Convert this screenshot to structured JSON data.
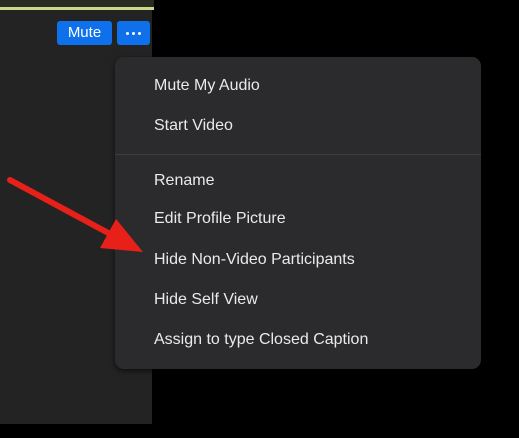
{
  "video_tile": {
    "mute_label": "Mute",
    "more_icon": "ellipsis-icon"
  },
  "menu": {
    "items": [
      {
        "label": "Mute My Audio"
      },
      {
        "label": "Start Video"
      },
      {
        "label": "Rename"
      },
      {
        "label": "Edit Profile Picture"
      },
      {
        "label": "Hide Non-Video Participants"
      },
      {
        "label": "Hide Self View"
      },
      {
        "label": "Assign to type Closed Caption"
      }
    ]
  },
  "annotation": {
    "arrow_icon": "red-arrow-icon",
    "arrow_color": "#e8201a"
  },
  "colors": {
    "accent": "#0e71eb",
    "menu_background": "#2b2b2d",
    "tile_background": "#232323",
    "active_speaker_border": "#c9d98a"
  }
}
